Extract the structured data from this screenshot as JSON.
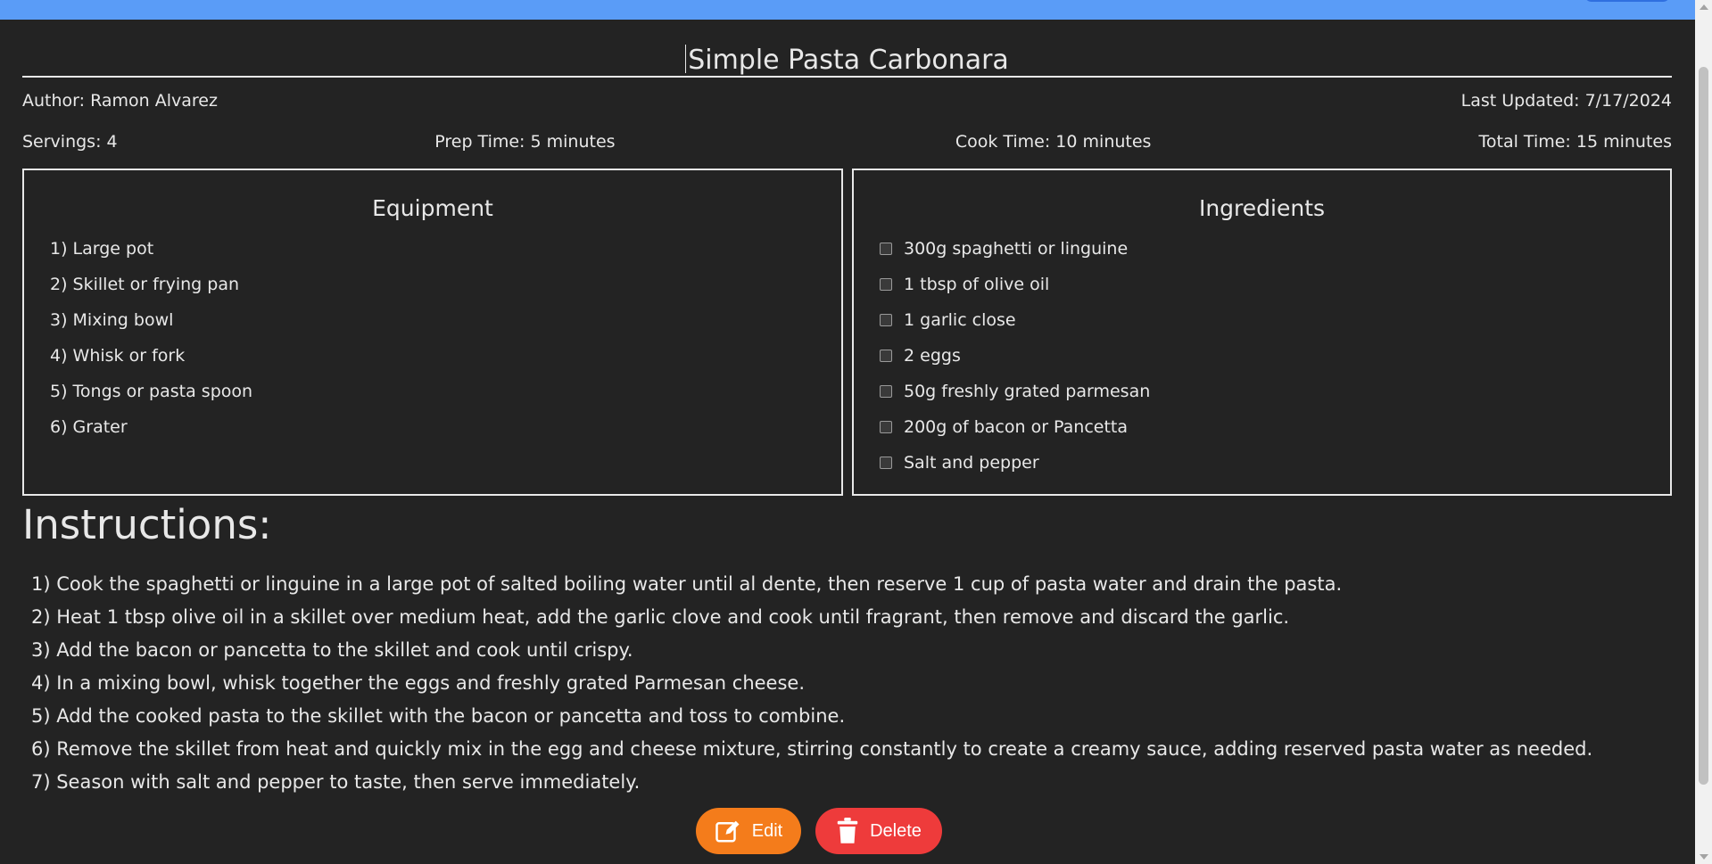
{
  "header": {
    "bar_color": "#5a9cf7"
  },
  "recipe": {
    "title": "Simple Pasta Carbonara",
    "author": "Author: Ramon Alvarez",
    "last_updated": "Last Updated: 7/17/2024",
    "servings": "Servings: 4",
    "prep_time": "Prep Time: 5 minutes",
    "cook_time": "Cook Time: 10 minutes",
    "total_time": "Total Time: 15 minutes"
  },
  "equipment": {
    "heading": "Equipment",
    "items": [
      "1) Large pot",
      "2) Skillet or frying pan",
      "3) Mixing bowl",
      "4) Whisk or fork",
      "5) Tongs or pasta spoon",
      "6) Grater"
    ]
  },
  "ingredients": {
    "heading": "Ingredients",
    "items": [
      {
        "label": "300g spaghetti or linguine",
        "checked": false
      },
      {
        "label": "1 tbsp of olive oil",
        "checked": false
      },
      {
        "label": "1 garlic close",
        "checked": false
      },
      {
        "label": "2 eggs",
        "checked": false
      },
      {
        "label": "50g freshly grated parmesan",
        "checked": false
      },
      {
        "label": "200g of bacon or Pancetta",
        "checked": false
      },
      {
        "label": "Salt and pepper",
        "checked": false
      }
    ]
  },
  "instructions": {
    "heading": "Instructions:",
    "steps": [
      "1) Cook the spaghetti or linguine in a large pot of salted boiling water until al dente, then reserve 1 cup of pasta water and drain the pasta.",
      "2) Heat 1 tbsp olive oil in a skillet over medium heat, add the garlic clove and cook until fragrant, then remove and discard the garlic.",
      "3) Add the bacon or pancetta to the skillet and cook until crispy.",
      "4) In a mixing bowl, whisk together the eggs and freshly grated Parmesan cheese.",
      "5) Add the cooked pasta to the skillet with the bacon or pancetta and toss to combine.",
      "6) Remove the skillet from heat and quickly mix in the egg and cheese mixture, stirring constantly to create a creamy sauce, adding reserved pasta water as needed.",
      "7) Season with salt and pepper to taste, then serve immediately."
    ]
  },
  "actions": {
    "edit_label": "Edit",
    "edit_icon": "edit-icon",
    "edit_color": "#f47c1b",
    "delete_label": "Delete",
    "delete_icon": "trash-icon",
    "delete_color": "#ee3b3b"
  }
}
